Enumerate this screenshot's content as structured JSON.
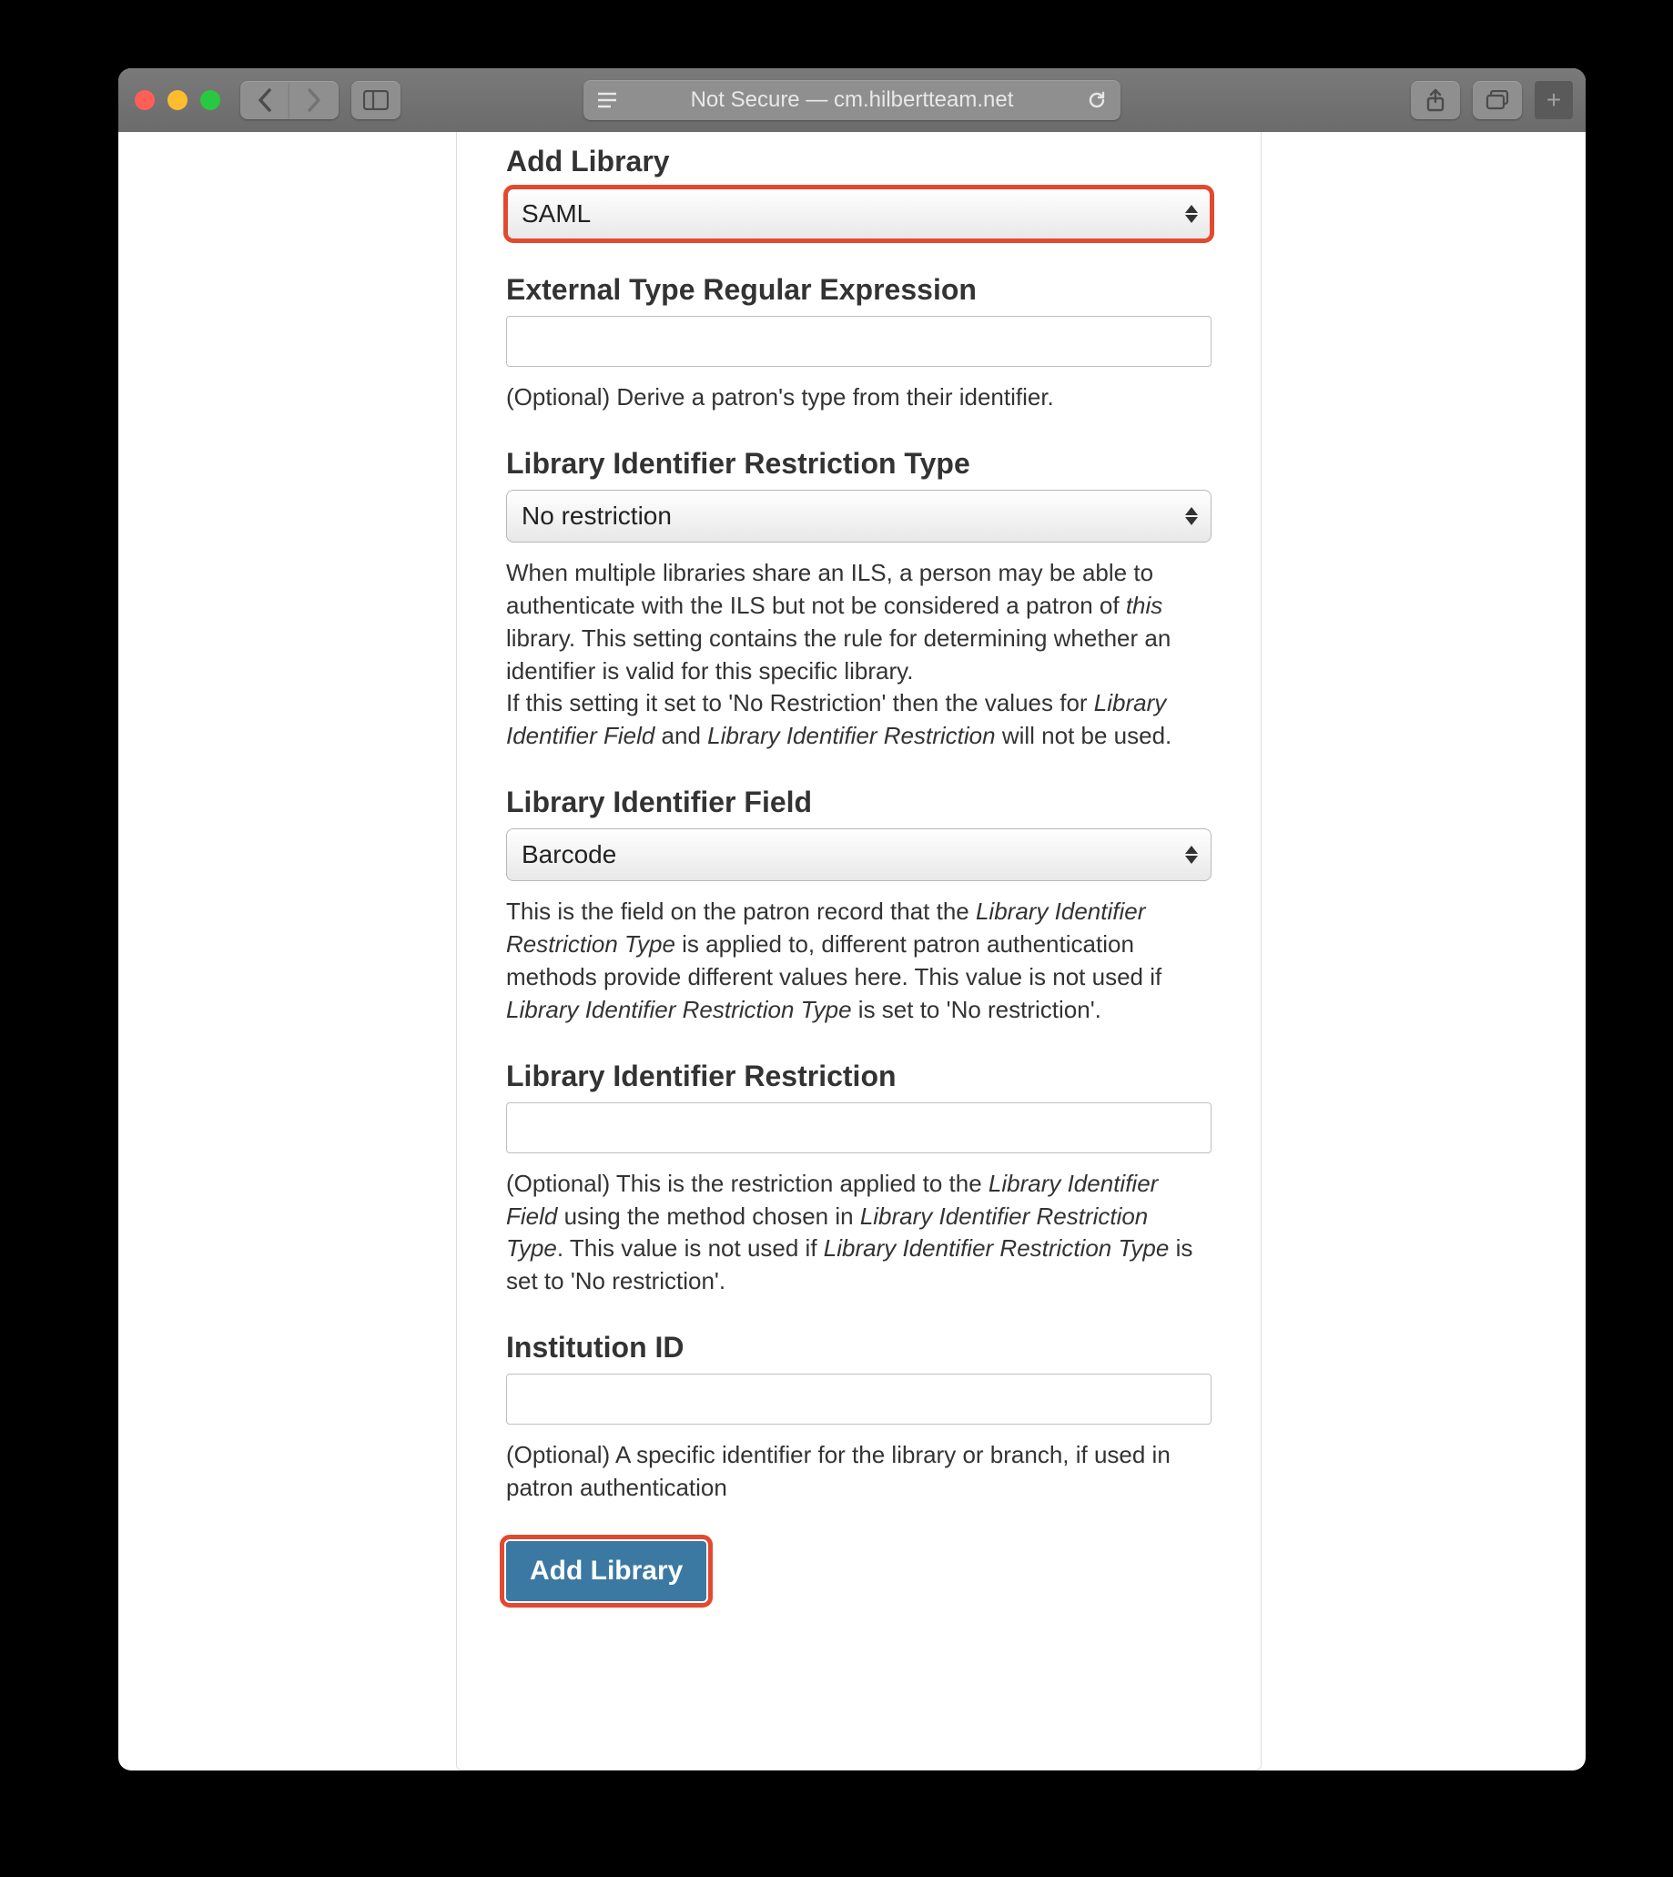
{
  "browser": {
    "address_text": "Not Secure — cm.hilbertteam.net"
  },
  "form": {
    "add_library": {
      "label": "Add Library",
      "value": "SAML"
    },
    "ext_regex": {
      "label": "External Type Regular Expression",
      "value": "",
      "help": "(Optional) Derive a patron's type from their identifier."
    },
    "restriction_type": {
      "label": "Library Identifier Restriction Type",
      "value": "No restriction",
      "help1": "When multiple libraries share an ILS, a person may be able to authenticate with the ILS but not be considered a patron of ",
      "help1_em": "this",
      "help1b": " library. This setting contains the rule for determining whether an identifier is valid for this specific library.",
      "help2a": "If this setting it set to 'No Restriction' then the values for ",
      "help2_em1": "Library Identifier Field",
      "help2b": " and ",
      "help2_em2": "Library Identifier Restriction",
      "help2c": " will not be used."
    },
    "identifier_field": {
      "label": "Library Identifier Field",
      "value": "Barcode",
      "help_a": "This is the field on the patron record that the ",
      "help_em1": "Library Identifier Restriction Type",
      "help_b": " is applied to, different patron authentication methods provide different values here. This value is not used if ",
      "help_em2": "Library Identifier Restriction Type",
      "help_c": " is set to 'No restriction'."
    },
    "restriction": {
      "label": "Library Identifier Restriction",
      "value": "",
      "help_a": "(Optional) This is the restriction applied to the ",
      "help_em1": "Library Identifier Field",
      "help_b": " using the method chosen in ",
      "help_em2": "Library Identifier Restriction Type",
      "help_c": ". This value is not used if ",
      "help_em3": "Library Identifier Restriction Type",
      "help_d": " is set to 'No restriction'."
    },
    "institution": {
      "label": "Institution ID",
      "value": "",
      "help": "(Optional) A specific identifier for the library or branch, if used in patron authentication"
    },
    "submit": {
      "label": "Add Library"
    }
  }
}
